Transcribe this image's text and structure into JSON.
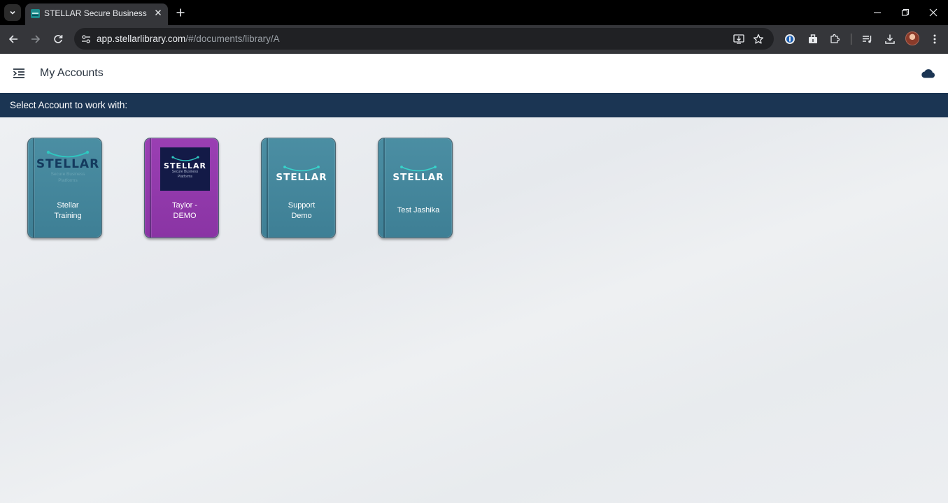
{
  "browser": {
    "tab_title": "STELLAR Secure Business",
    "url_host": "app.stellarlibrary.com",
    "url_path": "/#/documents/library/A"
  },
  "header": {
    "title": "My Accounts"
  },
  "select_bar": {
    "text": "Select Account to work with:"
  },
  "accounts": [
    {
      "name_line1": "Stellar",
      "name_line2": "Training",
      "logo_text": "STELLAR",
      "logo_tagline_1": "Secure Business",
      "logo_tagline_2": "Platforms",
      "color": "#4589a0"
    },
    {
      "name_line1": "Taylor -",
      "name_line2": "DEMO",
      "logo_text": "STELLAR",
      "logo_tagline_1": "Secure Business",
      "logo_tagline_2": "Platforms",
      "color": "#9339ab"
    },
    {
      "name_line1": "Support",
      "name_line2": "Demo",
      "logo_text": "STELLAR",
      "color": "#4589a0"
    },
    {
      "name_line1": "Test Jashika",
      "logo_text": "STELLAR",
      "color": "#4589a0"
    }
  ],
  "icons": {
    "tab_search": "chevron-down-icon",
    "favicon": "stellar-favicon-icon",
    "tab_close": "close-icon",
    "new_tab": "plus-icon",
    "back": "arrow-left-icon",
    "forward": "arrow-right-icon",
    "reload": "reload-icon",
    "site_info": "tune-icon",
    "install": "install-app-icon",
    "bookmark": "star-icon",
    "menu": "menu-icon",
    "cloud": "cloud-icon"
  },
  "colors": {
    "select_bar": "#1b3553",
    "card_teal": "#4589a0",
    "card_purple": "#9339ab",
    "logo_navy": "#143a5e"
  }
}
